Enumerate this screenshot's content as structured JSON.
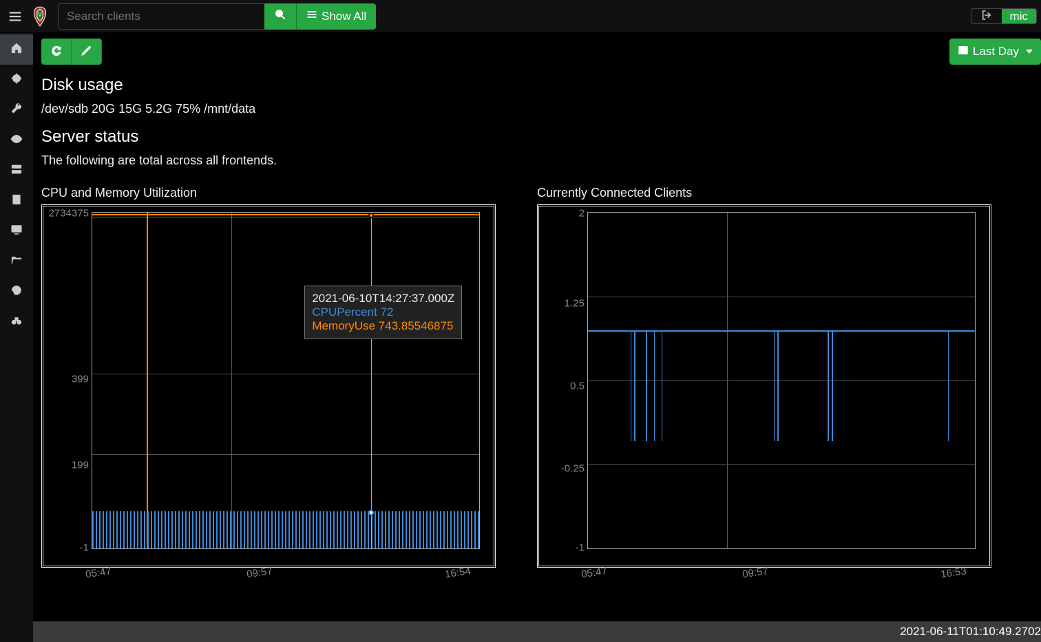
{
  "header": {
    "search_placeholder": "Search clients",
    "showall_label": "Show All",
    "username": "mic"
  },
  "sidenav": {
    "items": [
      {
        "name": "home-icon"
      },
      {
        "name": "target-icon"
      },
      {
        "name": "wrench-icon"
      },
      {
        "name": "eye-icon"
      },
      {
        "name": "server-icon"
      },
      {
        "name": "book-icon"
      },
      {
        "name": "monitor-icon"
      },
      {
        "name": "folder-open-icon"
      },
      {
        "name": "history-icon"
      },
      {
        "name": "binoculars-icon"
      }
    ]
  },
  "toolbar": {
    "time_range_label": "Last Day"
  },
  "sections": {
    "disk": {
      "title": "Disk usage",
      "line": "/dev/sdb 20G 15G 5.2G 75% /mnt/data"
    },
    "status": {
      "title": "Server status",
      "line": "The following are total across all frontends."
    }
  },
  "colors": {
    "cpu": "#3b8bd6",
    "memory": "#ff8c00",
    "green": "#28a745"
  },
  "chart_data": [
    {
      "type": "line",
      "title": "CPU and Memory Utilization",
      "xlabel": "",
      "ylabel": "",
      "x_ticks": [
        "05:47",
        "09:57",
        "16:54"
      ],
      "y_ticks": [
        "2734375",
        "399",
        "199",
        "-1"
      ],
      "ylim": [
        -1,
        2734375
      ],
      "cursor_time": "2021-06-10T14:27:37.000Z",
      "tooltip": {
        "time": "2021-06-10T14:27:37.000Z",
        "cpu_label": "CPUPercent",
        "cpu_value": "72",
        "mem_label": "MemoryUse",
        "mem_value": "743.85546875"
      },
      "series": [
        {
          "name": "CPUPercent",
          "color": "#3b8bd6",
          "approx": "noisy band oscillating roughly 0–60 across the day"
        },
        {
          "name": "MemoryUse",
          "color": "#ff8c00",
          "approx": "flat near ~740 with a brief spike to ~2734375 around 07:10"
        }
      ]
    },
    {
      "type": "line",
      "title": "Currently Connected Clients",
      "xlabel": "",
      "ylabel": "",
      "x_ticks": [
        "05:47",
        "09:57",
        "16:53"
      ],
      "y_ticks": [
        "2",
        "1.25",
        "0.5",
        "-0.25",
        "-1"
      ],
      "ylim": [
        -1,
        2
      ],
      "series": [
        {
          "name": "clients",
          "color": "#3b8bd6",
          "approx": "holds at 1 with several brief drops to 0"
        }
      ]
    }
  ],
  "footer": {
    "timestamp": "2021-06-11T01:10:49.2702"
  }
}
